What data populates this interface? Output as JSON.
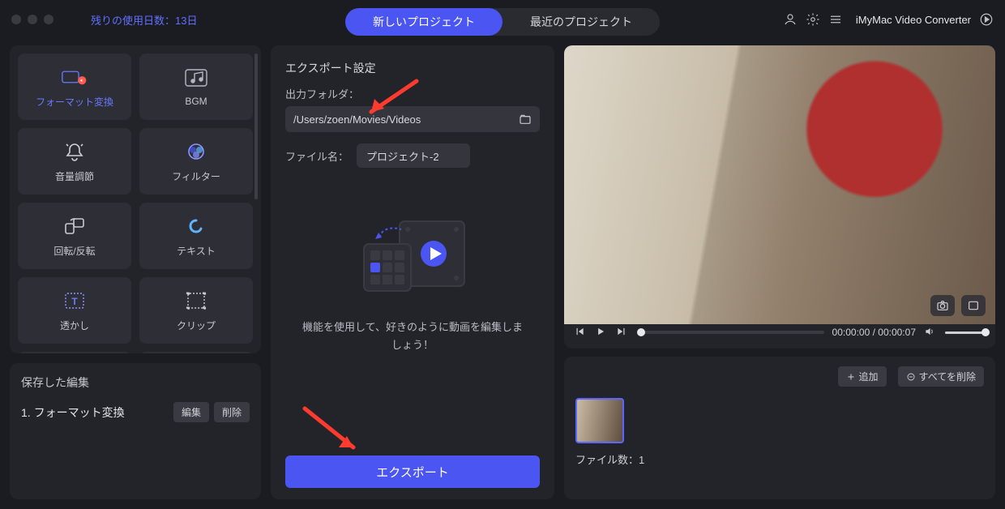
{
  "titlebar": {
    "trial_label": "残りの使用日数：13日",
    "tab_new": "新しいプロジェクト",
    "tab_recent": "最近のプロジェクト",
    "app_name": "iMyMac Video Converter"
  },
  "sidebar": {
    "tools": [
      {
        "id": "format",
        "label": "フォーマット変換",
        "active": true
      },
      {
        "id": "bgm",
        "label": "BGM"
      },
      {
        "id": "volume",
        "label": "音量調節"
      },
      {
        "id": "filter",
        "label": "フィルター"
      },
      {
        "id": "rotate",
        "label": "回転/反転"
      },
      {
        "id": "text",
        "label": "テキスト"
      },
      {
        "id": "watermark",
        "label": "透かし"
      },
      {
        "id": "clip",
        "label": "クリップ"
      }
    ],
    "saved_title": "保存した編集",
    "saved_item": "1.  フォーマット変換",
    "edit_label": "編集",
    "delete_label": "削除"
  },
  "export": {
    "heading": "エクスポート設定",
    "folder_label": "出力フォルダ：",
    "folder_path": "/Users/zoen/Movies/Videos",
    "filename_label": "ファイル名：",
    "filename_value": "プロジェクト-2",
    "hint": "機能を使用して、好きのように動画を編集しましょう！",
    "export_btn": "エクスポート"
  },
  "player": {
    "time_current": "00:00:00",
    "time_total": "00:00:07"
  },
  "files": {
    "add_label": "追加",
    "clear_label": "すべてを削除",
    "count_label": "ファイル数：1"
  }
}
